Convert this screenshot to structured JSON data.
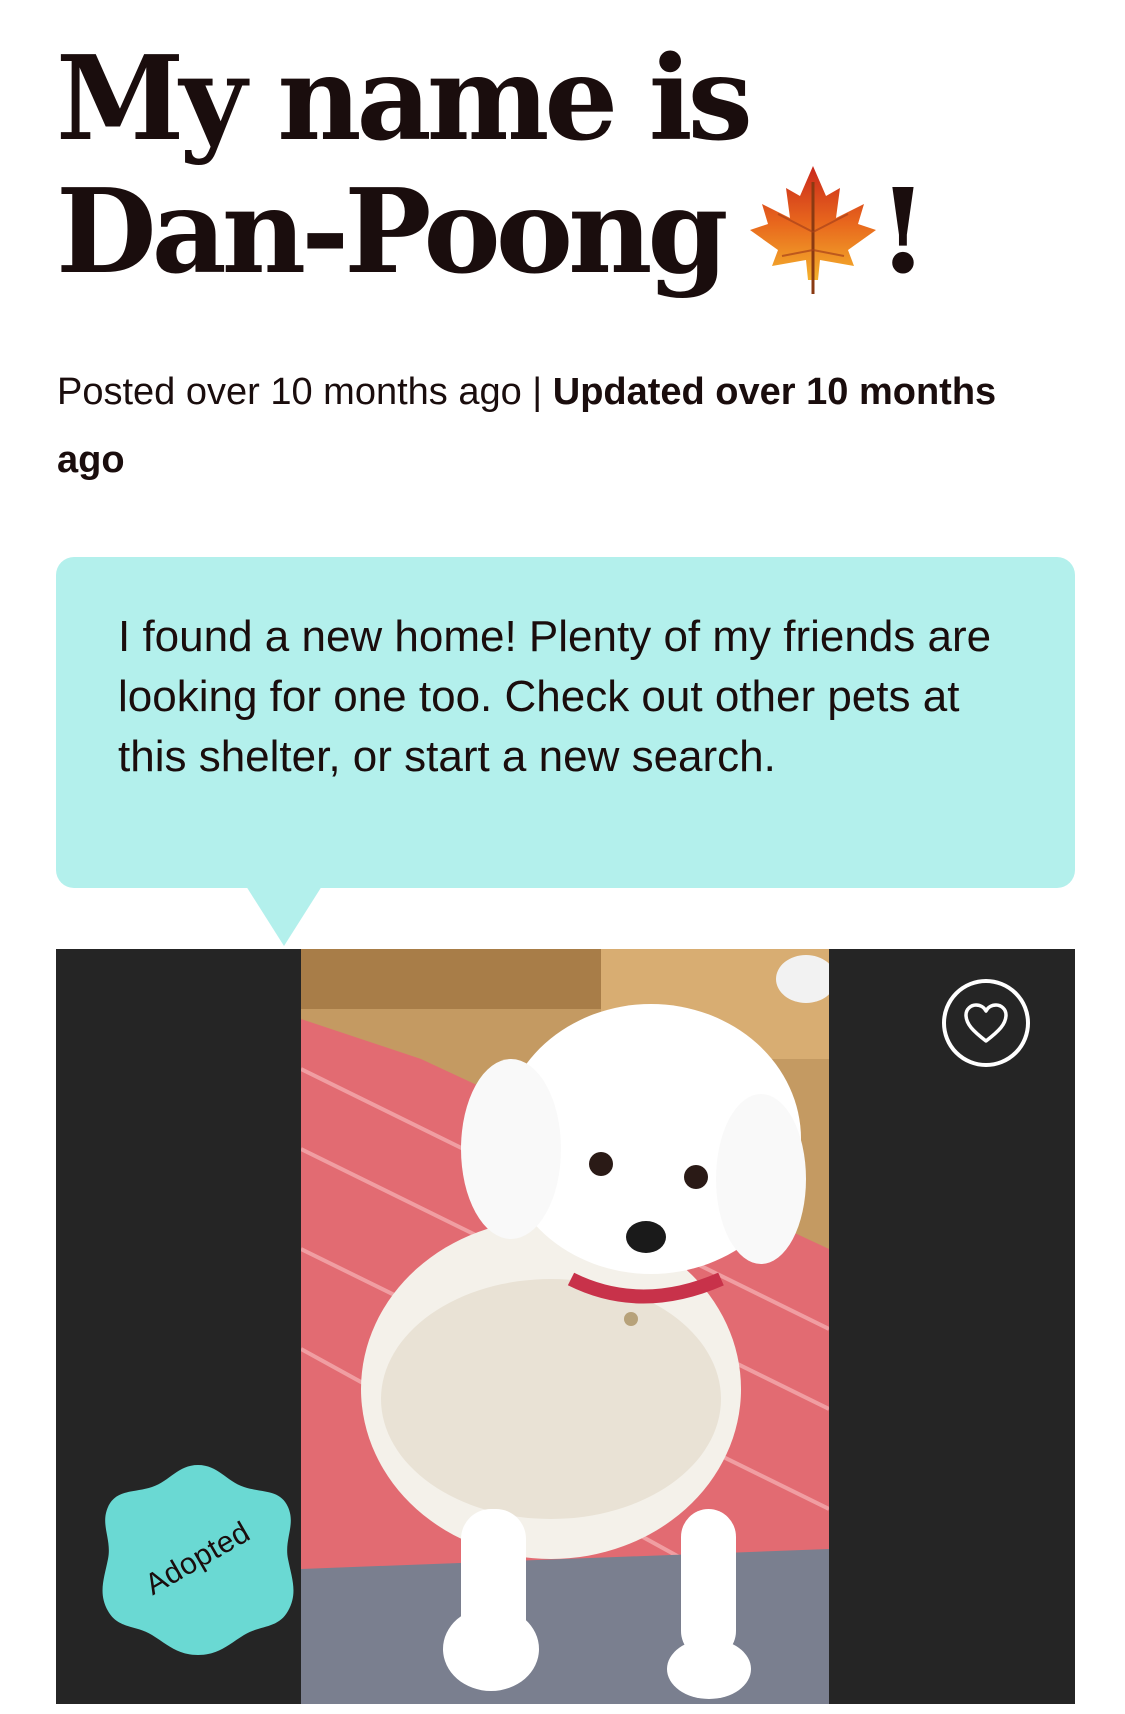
{
  "pet": {
    "title_text": "My name is Dan-Poong",
    "title_icon": "maple-leaf-emoji",
    "title_suffix": "!"
  },
  "meta": {
    "posted": "Posted over 10 months ago",
    "separator": " | ",
    "updated": "Updated over 10 months ago"
  },
  "notice": {
    "message": "I found a new home! Plenty of my friends are looking for one too. Check out other pets at this shelter, or start a new search.",
    "background_color": "#b3f0ec"
  },
  "gallery": {
    "favorite_icon": "heart-outline-icon",
    "status_badge": "Adopted",
    "badge_color": "#6ad9d3",
    "backdrop_color": "#252525"
  }
}
